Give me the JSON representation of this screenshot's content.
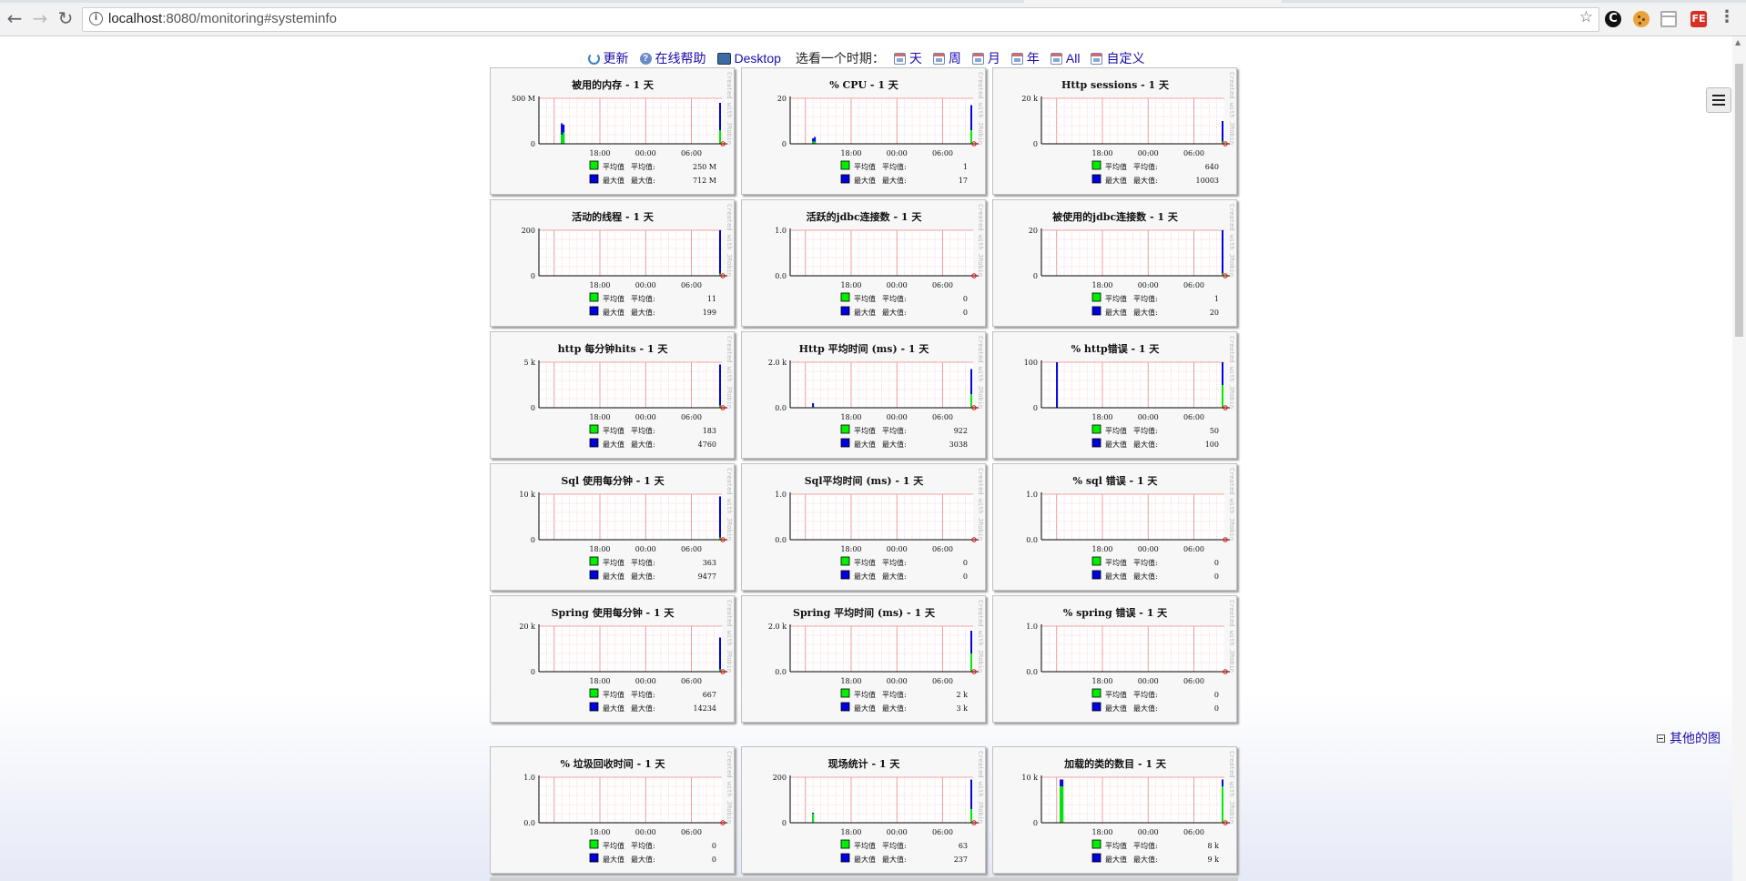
{
  "browser": {
    "url_host": "localhost",
    "url_rest": ":8080/monitoring#systeminfo"
  },
  "header": {
    "links": [
      {
        "icon": "refresh-icon",
        "label": "更新"
      },
      {
        "icon": "help-icon",
        "label": "在线帮助"
      },
      {
        "icon": "desktop-icon",
        "label": "Desktop"
      }
    ],
    "period_label": "选看一个时期：",
    "periods": [
      "天",
      "周",
      "月",
      "年",
      "All",
      "自定义"
    ]
  },
  "other_charts_label": "其他的图",
  "credit_text": "Created with JRobin",
  "legend_labels": {
    "avg_name": "平均值",
    "max_name": "最大值",
    "avg": "平均值:",
    "max": "最大值:"
  },
  "colors": {
    "avg": "#00ee00",
    "max": "#0000dd",
    "grid_minor": "#ffd0d0",
    "grid_major": "#ee8888",
    "link": "#1a0dab"
  },
  "chart_data": [
    {
      "type": "area",
      "title": "被用的内存 - 1 天",
      "x_ticks": [
        "18:00",
        "00:00",
        "06:00"
      ],
      "y_ticks": [
        "500 M",
        "0"
      ],
      "ylim": [
        0,
        800
      ],
      "avg": "250 M",
      "max": "712 M",
      "spikes": [
        {
          "x": 0.12,
          "avg": 0.2,
          "max": 0.45
        },
        {
          "x": 0.13,
          "avg": 0.25,
          "max": 0.42
        },
        {
          "x": 0.985,
          "avg": 0.3,
          "max": 0.9
        }
      ]
    },
    {
      "type": "area",
      "title": "% CPU - 1 天",
      "x_ticks": [
        "18:00",
        "00:00",
        "06:00"
      ],
      "y_ticks": [
        "20",
        "0"
      ],
      "ylim": [
        0,
        20
      ],
      "avg": "1",
      "max": "17",
      "spikes": [
        {
          "x": 0.12,
          "avg": 0.05,
          "max": 0.12
        },
        {
          "x": 0.13,
          "avg": 0.05,
          "max": 0.15
        },
        {
          "x": 0.985,
          "avg": 0.3,
          "max": 0.85
        }
      ]
    },
    {
      "type": "area",
      "title": "Http sessions - 1 天",
      "x_ticks": [
        "18:00",
        "00:00",
        "06:00"
      ],
      "y_ticks": [
        "20 k",
        "0"
      ],
      "ylim": [
        0,
        20000
      ],
      "avg": "640",
      "max": "10003",
      "spikes": [
        {
          "x": 0.985,
          "avg": 0.05,
          "max": 0.5
        }
      ]
    },
    {
      "type": "area",
      "title": "活动的线程 - 1 天",
      "x_ticks": [
        "18:00",
        "00:00",
        "06:00"
      ],
      "y_ticks": [
        "200",
        "0"
      ],
      "ylim": [
        0,
        200
      ],
      "avg": "11",
      "max": "199",
      "spikes": [
        {
          "x": 0.985,
          "avg": 0.05,
          "max": 1.0
        }
      ]
    },
    {
      "type": "area",
      "title": "活跃的jdbc连接数 - 1 天",
      "x_ticks": [
        "18:00",
        "00:00",
        "06:00"
      ],
      "y_ticks": [
        "1.0",
        "0.0"
      ],
      "ylim": [
        0,
        1
      ],
      "avg": "0",
      "max": "0",
      "spikes": []
    },
    {
      "type": "area",
      "title": "被使用的jdbc连接数 - 1 天",
      "x_ticks": [
        "18:00",
        "00:00",
        "06:00"
      ],
      "y_ticks": [
        "20",
        "0"
      ],
      "ylim": [
        0,
        20
      ],
      "avg": "1",
      "max": "20",
      "spikes": [
        {
          "x": 0.985,
          "avg": 0.05,
          "max": 1.0
        }
      ]
    },
    {
      "type": "area",
      "title": "http 每分钟hits - 1 天",
      "x_ticks": [
        "18:00",
        "00:00",
        "06:00"
      ],
      "y_ticks": [
        "5 k",
        "0"
      ],
      "ylim": [
        0,
        5000
      ],
      "avg": "183",
      "max": "4760",
      "spikes": [
        {
          "x": 0.985,
          "avg": 0.05,
          "max": 0.95
        }
      ]
    },
    {
      "type": "area",
      "title": "Http 平均时间 (ms) - 1 天",
      "x_ticks": [
        "18:00",
        "00:00",
        "06:00"
      ],
      "y_ticks": [
        "2.0 k",
        "0.0"
      ],
      "ylim": [
        0,
        4000
      ],
      "avg": "922",
      "max": "3038",
      "spikes": [
        {
          "x": 0.12,
          "avg": 0.02,
          "max": 0.1
        },
        {
          "x": 0.985,
          "avg": 0.3,
          "max": 0.85
        }
      ]
    },
    {
      "type": "area",
      "title": "% http错误 - 1 天",
      "x_ticks": [
        "18:00",
        "00:00",
        "06:00"
      ],
      "y_ticks": [
        "100",
        "0"
      ],
      "ylim": [
        0,
        100
      ],
      "avg": "50",
      "max": "100",
      "spikes": [
        {
          "x": 0.08,
          "avg": 0.0,
          "max": 1.0
        },
        {
          "x": 0.985,
          "avg": 0.5,
          "max": 1.0
        }
      ]
    },
    {
      "type": "area",
      "title": "Sql 使用每分钟 - 1 天",
      "x_ticks": [
        "18:00",
        "00:00",
        "06:00"
      ],
      "y_ticks": [
        "10 k",
        "0"
      ],
      "ylim": [
        0,
        10000
      ],
      "avg": "363",
      "max": "9477",
      "spikes": [
        {
          "x": 0.985,
          "avg": 0.05,
          "max": 0.95
        }
      ]
    },
    {
      "type": "area",
      "title": "Sql平均时间 (ms) - 1 天",
      "x_ticks": [
        "18:00",
        "00:00",
        "06:00"
      ],
      "y_ticks": [
        "1.0",
        "0.0"
      ],
      "ylim": [
        0,
        1
      ],
      "avg": "0",
      "max": "0",
      "spikes": []
    },
    {
      "type": "area",
      "title": "% sql 错误 - 1 天",
      "x_ticks": [
        "18:00",
        "00:00",
        "06:00"
      ],
      "y_ticks": [
        "1.0",
        "0.0"
      ],
      "ylim": [
        0,
        1
      ],
      "avg": "0",
      "max": "0",
      "spikes": []
    },
    {
      "type": "area",
      "title": "Spring 使用每分钟 - 1 天",
      "x_ticks": [
        "18:00",
        "00:00",
        "06:00"
      ],
      "y_ticks": [
        "20 k",
        "0"
      ],
      "ylim": [
        0,
        20000
      ],
      "avg": "667",
      "max": "14234",
      "spikes": [
        {
          "x": 0.985,
          "avg": 0.05,
          "max": 0.75
        }
      ]
    },
    {
      "type": "area",
      "title": "Spring 平均时间 (ms) - 1 天",
      "x_ticks": [
        "18:00",
        "00:00",
        "06:00"
      ],
      "y_ticks": [
        "2.0 k",
        "0.0"
      ],
      "ylim": [
        0,
        4000
      ],
      "avg": "2 k",
      "max": "3 k",
      "spikes": [
        {
          "x": 0.985,
          "avg": 0.4,
          "max": 0.9
        }
      ]
    },
    {
      "type": "area",
      "title": "% spring 错误 - 1 天",
      "x_ticks": [
        "18:00",
        "00:00",
        "06:00"
      ],
      "y_ticks": [
        "1.0",
        "0.0"
      ],
      "ylim": [
        0,
        1
      ],
      "avg": "0",
      "max": "0",
      "spikes": []
    },
    {
      "type": "area",
      "title": "% 垃圾回收时间 - 1 天",
      "x_ticks": [
        "18:00",
        "00:00",
        "06:00"
      ],
      "y_ticks": [
        "1.0",
        "0.0"
      ],
      "ylim": [
        0,
        1
      ],
      "avg": "0",
      "max": "0",
      "spikes": []
    },
    {
      "type": "area",
      "title": "现场统计 - 1 天",
      "x_ticks": [
        "18:00",
        "00:00",
        "06:00"
      ],
      "y_ticks": [
        "200",
        "0"
      ],
      "ylim": [
        0,
        300
      ],
      "avg": "63",
      "max": "237",
      "spikes": [
        {
          "x": 0.12,
          "avg": 0.2,
          "max": 0.22
        },
        {
          "x": 0.985,
          "avg": 0.3,
          "max": 0.95
        }
      ]
    },
    {
      "type": "area",
      "title": "加载的类的数目 - 1 天",
      "x_ticks": [
        "18:00",
        "00:00",
        "06:00"
      ],
      "y_ticks": [
        "10 k",
        "0"
      ],
      "ylim": [
        0,
        10000
      ],
      "avg": "8 k",
      "max": "9 k",
      "spikes": [
        {
          "x": 0.1,
          "avg": 0.8,
          "max": 0.95
        },
        {
          "x": 0.11,
          "avg": 0.8,
          "max": 0.95
        },
        {
          "x": 0.985,
          "avg": 0.8,
          "max": 0.95
        }
      ]
    }
  ]
}
